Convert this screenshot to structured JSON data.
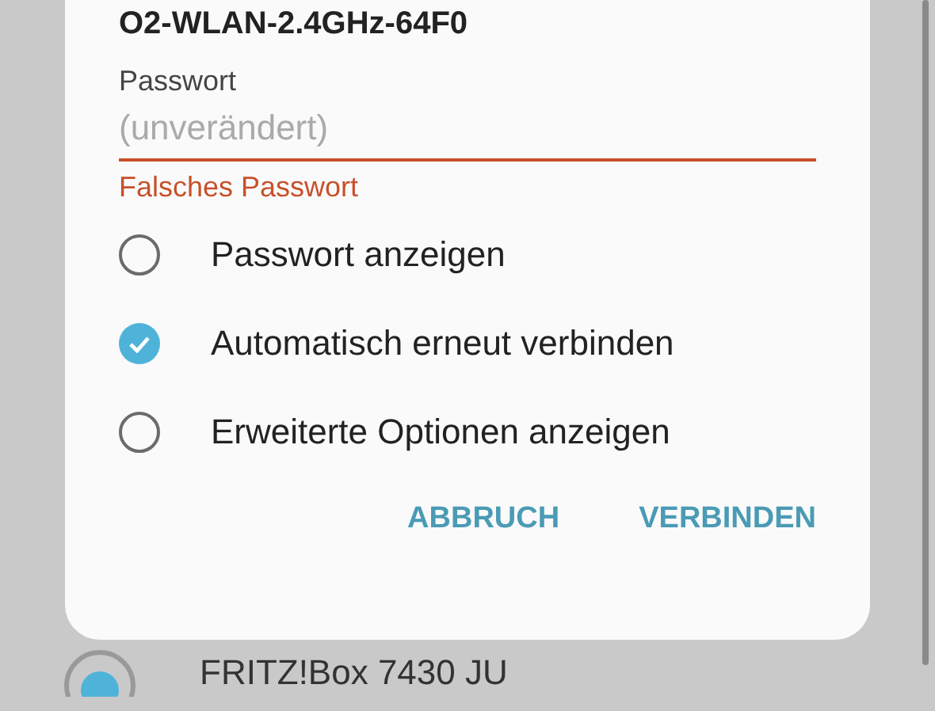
{
  "dialog": {
    "title": "O2-WLAN-2.4GHz-64F0",
    "password": {
      "label": "Passwort",
      "placeholder": "(unverändert)",
      "error": "Falsches Passwort"
    },
    "options": [
      {
        "label": "Passwort anzeigen",
        "checked": false
      },
      {
        "label": "Automatisch erneut verbinden",
        "checked": true
      },
      {
        "label": "Erweiterte Optionen anzeigen",
        "checked": false
      }
    ],
    "buttons": [
      "ABBRUCH",
      "VERBINDEN"
    ]
  },
  "background_list": {
    "items": [
      {
        "name": "FRITZ!Box 7430 JU"
      }
    ]
  }
}
